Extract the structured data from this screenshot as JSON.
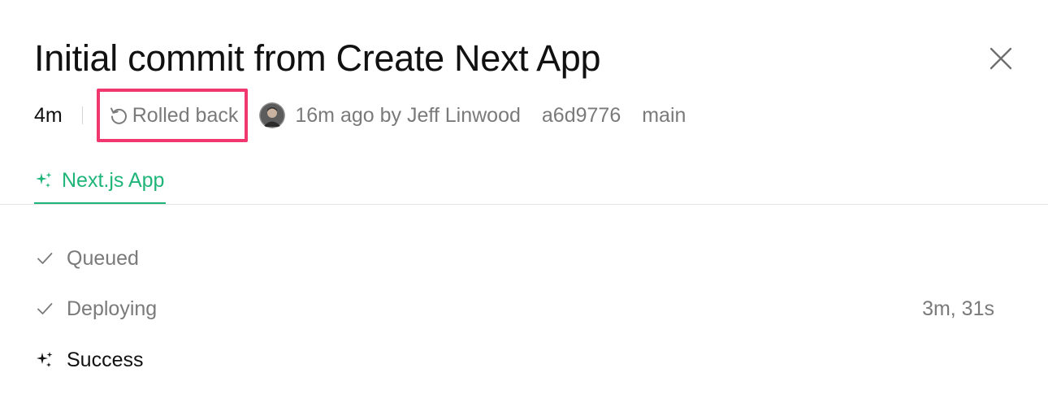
{
  "header": {
    "title": "Initial commit from Create Next App",
    "close_icon": "close-icon"
  },
  "meta": {
    "duration": "4m",
    "status": "Rolled back",
    "status_icon": "rollback-icon",
    "time_author": "16m ago by Jeff Linwood",
    "commit": "a6d9776",
    "branch": "main"
  },
  "tabs": [
    {
      "label": "Next.js App",
      "icon": "sparkle-icon",
      "active": true
    }
  ],
  "steps": [
    {
      "label": "Queued",
      "icon": "check-icon",
      "time": ""
    },
    {
      "label": "Deploying",
      "icon": "check-icon",
      "time": "3m, 31s"
    },
    {
      "label": "Success",
      "icon": "sparkle-icon",
      "time": ""
    }
  ],
  "colors": {
    "accent_green": "#1fb579",
    "highlight_border": "#f0376e",
    "muted_text": "#7a7a7a",
    "strong_text": "#111111"
  }
}
